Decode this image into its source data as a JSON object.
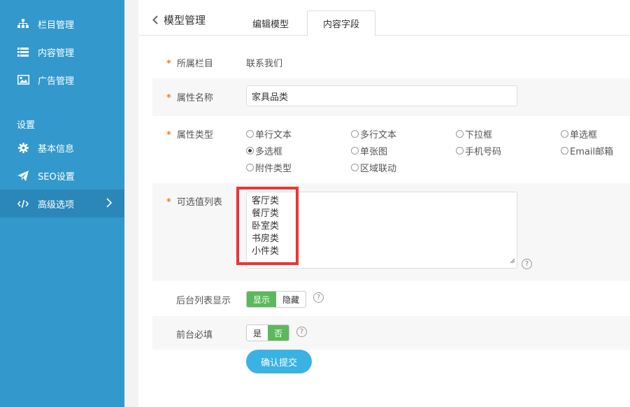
{
  "sidebar": {
    "items": [
      {
        "label": "栏目管理",
        "icon": "sitemap-icon"
      },
      {
        "label": "内容管理",
        "icon": "list-icon"
      },
      {
        "label": "广告管理",
        "icon": "image-icon"
      }
    ],
    "section_title": "设置",
    "settings": [
      {
        "label": "基本信息",
        "icon": "gear-icon"
      },
      {
        "label": "SEO设置",
        "icon": "paper-plane-icon"
      },
      {
        "label": "高级选项",
        "icon": "code-icon",
        "active": true
      }
    ],
    "colors": {
      "background": "#3399cc",
      "active": "#2a87b8"
    }
  },
  "header": {
    "back_label": "模型管理",
    "tabs": [
      {
        "label": "编辑模型"
      },
      {
        "label": "内容字段",
        "active": true
      }
    ]
  },
  "form": {
    "category": {
      "label": "所属栏目",
      "value": "联系我们"
    },
    "attr_name": {
      "label": "属性名称",
      "value": "家具品类"
    },
    "attr_type": {
      "label": "属性类型",
      "options": [
        "单行文本",
        "多行文本",
        "下拉框",
        "单选框",
        "多选框",
        "单张图",
        "手机号码",
        "Email邮箱",
        "附件类型",
        "区域联动"
      ],
      "selected": "多选框"
    },
    "option_list": {
      "label": "可选值列表",
      "values": [
        "客厅类",
        "餐厅类",
        "卧室类",
        "书房类",
        "小件类"
      ]
    },
    "backend_display": {
      "label": "后台列表显示",
      "on_label": "显示",
      "off_label": "隐藏",
      "selected": "显示"
    },
    "frontend_required": {
      "label": "前台必填",
      "yes_label": "是",
      "no_label": "否",
      "selected": "否"
    },
    "required_mark": "*",
    "help_mark": "?",
    "submit_label": "确认提交"
  },
  "colors": {
    "required": "#f0801e",
    "toggle_on": "#5cb85c",
    "submit": "#3ab2e2",
    "highlight": "#ee3333"
  }
}
